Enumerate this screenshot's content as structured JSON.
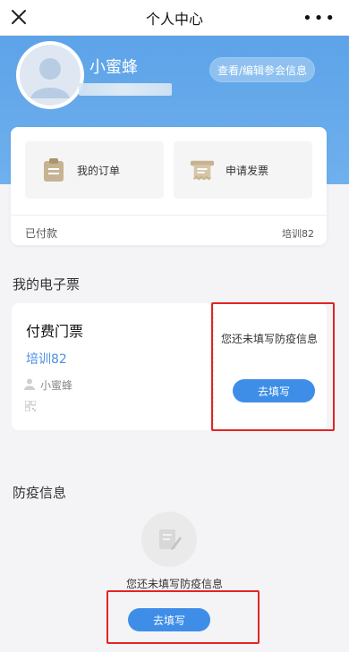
{
  "header": {
    "title": "个人中心"
  },
  "profile": {
    "name": "小蜜蜂",
    "edit_label": "查看/编辑参会信息"
  },
  "orders": {
    "my_orders_label": "我的订单",
    "invoice_label": "申请发票",
    "status_label": "已付款",
    "event_label": "培训82"
  },
  "etickets": {
    "section_title": "我的电子票",
    "ticket_name": "付费门票",
    "event_name": "培训82",
    "holder": "小蜜蜂",
    "notice": "您还未填写防疫信息",
    "fill_label": "去填写"
  },
  "epidemic": {
    "section_title": "防疫信息",
    "empty_text": "您还未填写防疫信息",
    "fill_label": "去填写"
  },
  "colors": {
    "accent": "#3e8ee8",
    "hero": "#5da3e8",
    "highlight": "#e22426",
    "link": "#4a90e2"
  },
  "icons": [
    "close-icon",
    "more-icon",
    "avatar-icon",
    "clipboard-icon",
    "invoice-icon",
    "person-icon",
    "qr-code-icon",
    "document-edit-icon"
  ]
}
